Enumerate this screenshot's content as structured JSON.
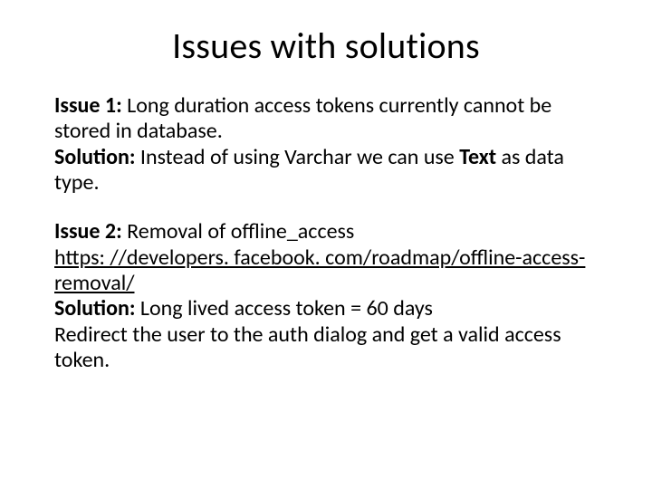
{
  "title": "Issues with solutions",
  "issue1": {
    "label": "Issue 1:",
    "text": " Long duration access tokens currently cannot be stored in database.",
    "solution_label": "Solution:",
    "solution_text_1": " Instead of using Varchar we can use ",
    "solution_bold": "Text",
    "solution_text_2": " as data type."
  },
  "issue2": {
    "label": "Issue 2:",
    "text": " Removal of offline_access",
    "link": "https: //developers. facebook. com/roadmap/offline-access-removal/",
    "solution_label": "Solution:",
    "solution_text": " Long lived access token = 60 days",
    "redirect_text": "Redirect the user to the auth dialog and get a valid access token."
  }
}
